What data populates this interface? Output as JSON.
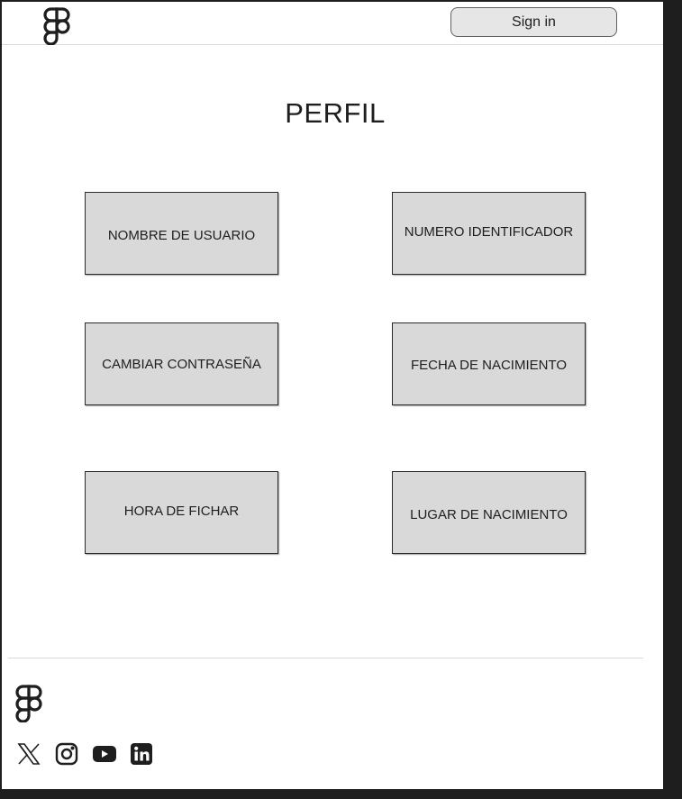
{
  "header": {
    "logo_icon": "figma-logo-icon",
    "signin_label": "Sign in"
  },
  "main": {
    "title": "PERFIL",
    "cards": [
      {
        "label": "NOMBRE DE USUARIO"
      },
      {
        "label": "NUMERO IDENTIFICADOR"
      },
      {
        "label": "CAMBIAR CONTRASEÑA"
      },
      {
        "label": "FECHA DE NACIMIENTO"
      },
      {
        "label": "HORA DE FICHAR"
      },
      {
        "label": "LUGAR DE NACIMIENTO"
      }
    ]
  },
  "footer": {
    "logo_icon": "figma-logo-icon",
    "social_icons": [
      "x-icon",
      "instagram-icon",
      "youtube-icon",
      "linkedin-icon"
    ]
  },
  "colors": {
    "background": "#1e1e1e",
    "frame": "#ffffff",
    "card_fill": "#d9d9d9",
    "button_fill": "#e6e6e6",
    "text": "#1e1e1e"
  }
}
